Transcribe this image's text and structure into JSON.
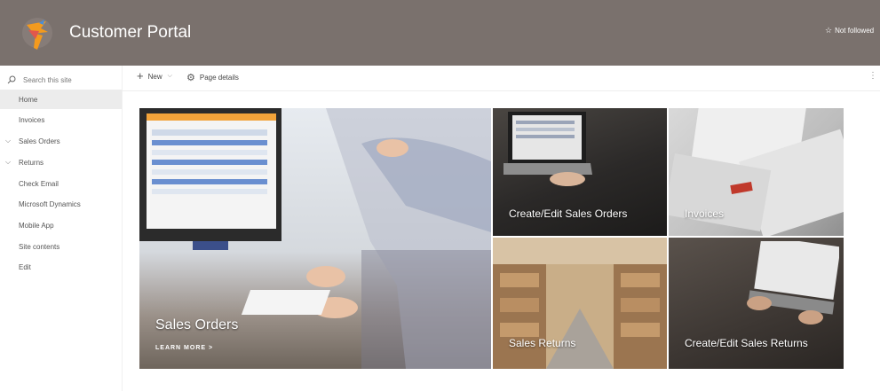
{
  "header": {
    "site_title": "Customer Portal",
    "follow_label": "Not followed",
    "bg_color": "#7a716d"
  },
  "sidebar": {
    "search_placeholder": "Search this site",
    "items": [
      {
        "label": "Home",
        "active": true
      },
      {
        "label": "Invoices"
      },
      {
        "label": "Sales Orders",
        "expandable": true
      },
      {
        "label": "Returns",
        "expandable": true
      },
      {
        "label": "Check Email"
      },
      {
        "label": "Microsoft Dynamics"
      },
      {
        "label": "Mobile App"
      },
      {
        "label": "Site contents"
      },
      {
        "label": "Edit"
      }
    ]
  },
  "command_bar": {
    "new_label": "New",
    "page_details_label": "Page details"
  },
  "hero": {
    "main": {
      "title": "Sales Orders",
      "link": "LEARN MORE >"
    },
    "tiles": [
      {
        "title": "Create/Edit Sales Orders"
      },
      {
        "title": "Invoices"
      },
      {
        "title": "Sales Returns"
      },
      {
        "title": "Create/Edit Sales Returns"
      }
    ]
  },
  "icons": {
    "logo": "customer-portal-logo",
    "search": "search-icon",
    "star": "star-icon",
    "new": "plus-icon",
    "settings": "gear-icon",
    "expand": "chevron-down-icon",
    "more": "ellipsis-icon"
  }
}
